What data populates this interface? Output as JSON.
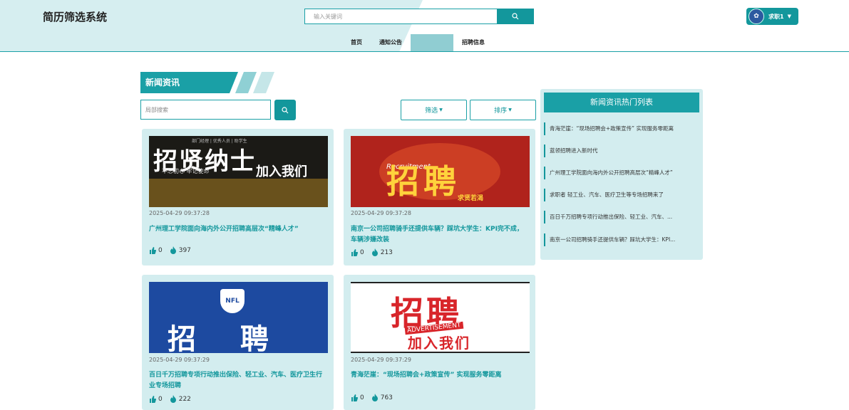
{
  "header": {
    "site_title": "简历筛选系统",
    "search_placeholder": "输入关键词",
    "user_name": "求职1"
  },
  "nav": {
    "items": [
      {
        "label": "首页"
      },
      {
        "label": "通知公告"
      },
      {
        "label": ""
      },
      {
        "label": "招聘信息"
      }
    ]
  },
  "section": {
    "title": "新闻资讯",
    "local_search_placeholder": "局部搜索",
    "filter_label": "筛选",
    "sort_label": "排序"
  },
  "cards": [
    {
      "date": "2025-04-29 09:37:28",
      "title": "广州理工学院面向海内外公开招聘高层次“精峰人才”",
      "likes": "0",
      "views": "397",
      "thumb_text_main": "招贤纳士",
      "thumb_text_sub": "加入我们",
      "thumb_text_top": "部门经理 | 优秀人员 | 助学生",
      "thumb_text_left": "不忘初心 牢记使命"
    },
    {
      "date": "2025-04-29 09:37:28",
      "title": "南京一公司招聘骑手还提供车辆？踩坑大学生：KPI完不成，车辆涉嫌改装",
      "likes": "0",
      "views": "213",
      "thumb_text_main": "招聘",
      "thumb_text_sub": "Recruitment",
      "thumb_text_tag": "求贤若渴"
    },
    {
      "date": "2025-04-29 09:37:29",
      "title": "百日千万招聘专项行动推出保险、轻工业、汽车、医疗卫生行业专场招聘",
      "likes": "0",
      "views": "222",
      "thumb_text_main": "招 聘",
      "thumb_text_badge": "NFL"
    },
    {
      "date": "2025-04-29 09:37:29",
      "title": "青海茫崖：“现场招聘会+政策宣传” 实现服务零距离",
      "likes": "0",
      "views": "763",
      "thumb_text_main": "招聘",
      "thumb_text_sub": "ADVERTISEMENT",
      "thumb_text_tag": "加入我们"
    }
  ],
  "hot_list": {
    "title": "新闻资讯热门列表",
    "items": [
      "青海茫崖：“现场招聘会+政策宣传” 实现服务零距离",
      "蓝领招聘进入新时代",
      "广州理工学院面向海内外公开招聘高层次“精峰人才”",
      "求职者 轻工业、汽车、医疗卫生等专场招聘来了",
      "百日千万招聘专项行动推出保险、轻工业、汽车、...",
      "南京一公司招聘骑手还提供车辆？踩坑大学生：KPI..."
    ]
  },
  "colors": {
    "accent": "#1aa0a6",
    "accent_dark": "#13979c",
    "card_bg": "#d3edef",
    "header_bg": "#d6eef0"
  }
}
